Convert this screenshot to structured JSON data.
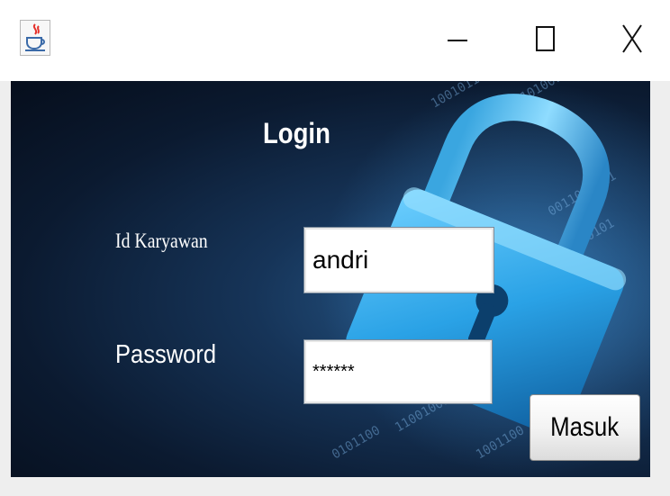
{
  "window": {
    "icon": "java-coffee-cup-icon",
    "controls": {
      "minimize": "minimize-icon",
      "maximize": "maximize-icon",
      "close": "close-icon"
    }
  },
  "form": {
    "title": "Login",
    "id_label": "Id Karyawan",
    "id_value": "andri",
    "password_label": "Password",
    "password_value": "******",
    "submit_label": "Masuk"
  },
  "background": {
    "image": "padlock-binary-code",
    "icon": "padlock-icon"
  }
}
